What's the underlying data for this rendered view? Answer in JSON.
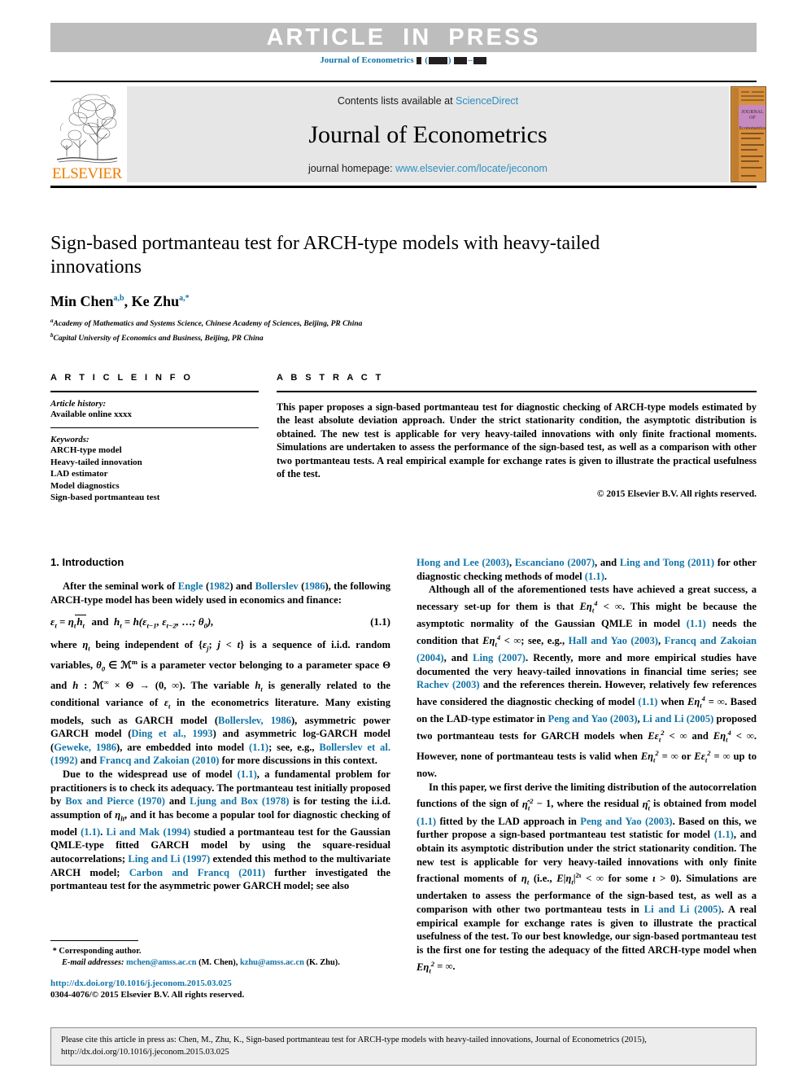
{
  "banner": {
    "text": "ARTICLE IN PRESS",
    "journal_ref_prefix": "Journal of Econometrics",
    "journal_ref_pattern": "▮ (▮▮▮▮) ▮▮▮–▮▮▮",
    "band_color": "#bdbdbd",
    "link_color": "#1274a8"
  },
  "masthead": {
    "publisher": "ELSEVIER",
    "contents_prefix": "Contents lists available at",
    "contents_link": "ScienceDirect",
    "journal_title": "Journal of Econometrics",
    "homepage_prefix": "journal homepage:",
    "homepage_url": "www.elsevier.com/locate/jeconom",
    "cover_title_line1": "JOURNAL OF",
    "cover_title_line2": "Econometrics",
    "cover_bg": "#d9903d",
    "cover_title_bg": "#c58ac0",
    "band_bg": "#e6e6e6",
    "elsevier_orange": "#f07d00",
    "link_blue": "#2c8fbf"
  },
  "article": {
    "title": "Sign-based portmanteau test for ARCH-type models with heavy-tailed innovations",
    "authors": [
      {
        "name": "Min Chen",
        "marks": "a,b"
      },
      {
        "name": "Ke Zhu",
        "marks": "a,*"
      }
    ],
    "affiliations": [
      {
        "mark": "a",
        "text": "Academy of Mathematics and Systems Science, Chinese Academy of Sciences, Beijing, PR China"
      },
      {
        "mark": "b",
        "text": "Capital University of Economics and Business, Beijing, PR China"
      }
    ]
  },
  "info": {
    "heading": "A R T I C L E   I N F O",
    "history_label": "Article history:",
    "history_value": "Available online xxxx",
    "keywords_label": "Keywords:",
    "keywords": [
      "ARCH-type model",
      "Heavy-tailed innovation",
      "LAD estimator",
      "Model diagnostics",
      "Sign-based portmanteau test"
    ]
  },
  "abstract": {
    "heading": "A B S T R A C T",
    "body": "This paper proposes a sign-based portmanteau test for diagnostic checking of ARCH-type models estimated by the least absolute deviation approach. Under the strict stationarity condition, the asymptotic distribution is obtained. The new test is applicable for very heavy-tailed innovations with only finite fractional moments. Simulations are undertaken to assess the performance of the sign-based test, as well as a comparison with other two portmanteau tests. A real empirical example for exchange rates is given to illustrate the practical usefulness of the test.",
    "copyright": "© 2015 Elsevier B.V. All rights reserved."
  },
  "intro": {
    "section_title": "1. Introduction",
    "equation_number": "(1.1)",
    "left_paragraphs": {
      "p1_a": "After the seminal work of ",
      "p1_link1": "Engle",
      "p1_b": " (",
      "p1_link2": "1982",
      "p1_c": ") and ",
      "p1_link3": "Bollerslev",
      "p1_d": " (",
      "p1_link4": "1986",
      "p1_e": "), the following ARCH-type model has been widely used in economics and finance:"
    },
    "left_text_2": "where ηt being independent of {εj; j < t} is a sequence of i.i.d. random variables, θ0 ∈ ℛm is a parameter vector belonging to a parameter space Θ and h : ℛ∞ × Θ → (0, ∞). The variable ht is generally related to the conditional variance of εt in the econometrics literature. Many existing models, such as GARCH model (Bollerslev, 1986), asymmetric power GARCH model (Ding et al., 1993) and asymmetric log-GARCH model (Geweke, 1986), are embedded into model (1.1); see, e.g., Bollerslev et al. (1992) and Francq and Zakoian (2010) for more discussions in this context.",
    "left_text_3": "Due to the widespread use of model (1.1), a fundamental problem for practitioners is to check its adequacy. The portmanteau test initially proposed by Box and Pierce (1970) and Ljung and Box (1978) is for testing the i.i.d. assumption of ηt, and it has become a popular tool for diagnostic checking of model (1.1). Li and Mak (1994) studied a portmanteau test for the Gaussian QMLE-type fitted GARCH model by using the square-residual autocorrelations; Ling and Li (1997) extended this method to the multivariate ARCH model; Carbon and Francq (2011) further investigated the portmanteau test for the asymmetric power GARCH model; see also",
    "right_text_1": "Hong and Lee (2003), Escanciano (2007), and Ling and Tong (2011) for other diagnostic checking methods of model (1.1).",
    "right_text_2": "Although all of the aforementioned tests have achieved a great success, a necessary set-up for them is that Eηt4 < ∞. This might be because the asymptotic normality of the Gaussian QMLE in model (1.1) needs the condition that Eηt4 < ∞; see, e.g., Hall and Yao (2003), Francq and Zakoian (2004), and Ling (2007). Recently, more and more empirical studies have documented the very heavy-tailed innovations in financial time series; see Rachev (2003) and the references therein. However, relatively few references have considered the diagnostic checking of model (1.1) when Eηt4 = ∞. Based on the LAD-type estimator in Peng and Yao (2003), Li and Li (2005) proposed two portmanteau tests for GARCH models when Eεt2 < ∞ and Eηt4 < ∞. However, none of portmanteau tests is valid when Eηt2 = ∞ or Eεt2 = ∞ up to now.",
    "right_text_3": "In this paper, we first derive the limiting distribution of the autocorrelation functions of the sign of η̂t2 − 1, where the residual η̂t is obtained from model (1.1) fitted by the LAD approach in Peng and Yao (2003). Based on this, we further propose a sign-based portmanteau test statistic for model (1.1), and obtain its asymptotic distribution under the strict stationarity condition. The new test is applicable for very heavy-tailed innovations with only finite fractional moments of ηt (i.e., E|ηt|2ι < ∞ for some ι > 0). Simulations are undertaken to assess the performance of the sign-based test, as well as a comparison with other two portmanteau tests in Li and Li (2005). A real empirical example for exchange rates is given to illustrate the practical usefulness of the test. To our best knowledge, our sign-based portmanteau test is the first one for testing the adequacy of the fitted ARCH-type model when Eηt2 = ∞."
  },
  "footnote": {
    "corresponding_mark": "*",
    "corresponding_text": "Corresponding author.",
    "email_label": "E-mail addresses:",
    "email1": "mchen@amss.ac.cn",
    "email1_who": "(M. Chen),",
    "email2": "kzhu@amss.ac.cn",
    "email2_who": "(K. Zhu).",
    "doi": "http://dx.doi.org/10.1016/j.jeconom.2015.03.025",
    "issn": "0304-4076/© 2015 Elsevier B.V. All rights reserved."
  },
  "citation_box": {
    "line1": "Please cite this article in press as: Chen, M., Zhu, K., Sign-based portmanteau test for ARCH-type models with heavy-tailed innovations, Journal of Econometrics (2015),",
    "line2": "http://dx.doi.org/10.1016/j.jeconom.2015.03.025"
  }
}
